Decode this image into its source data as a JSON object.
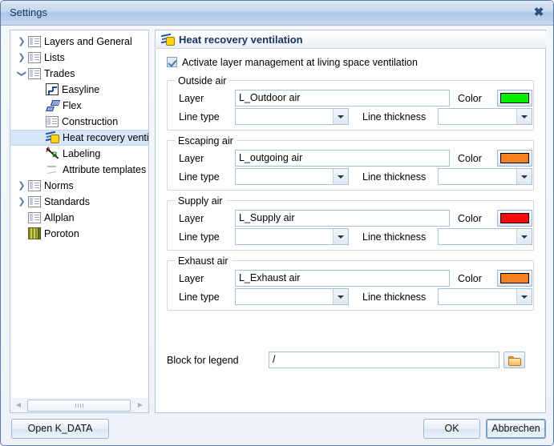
{
  "window": {
    "title": "Settings",
    "close_icon": "close-icon"
  },
  "sidebar": {
    "items": [
      {
        "label": "Layers and General",
        "icon": "page-icon",
        "twisty": "collapsed",
        "indent": 0,
        "selected": false
      },
      {
        "label": "Lists",
        "icon": "page-icon",
        "twisty": "collapsed",
        "indent": 0,
        "selected": false
      },
      {
        "label": "Trades",
        "icon": "page-icon",
        "twisty": "expanded",
        "indent": 0,
        "selected": false
      },
      {
        "label": "Easyline",
        "icon": "easyline-icon",
        "twisty": "none",
        "indent": 1,
        "selected": false
      },
      {
        "label": "Flex",
        "icon": "flex-icon",
        "twisty": "none",
        "indent": 1,
        "selected": false
      },
      {
        "label": "Construction",
        "icon": "page-icon",
        "twisty": "none",
        "indent": 1,
        "selected": false
      },
      {
        "label": "Heat recovery ventilation",
        "icon": "heat-recovery-icon",
        "twisty": "none",
        "indent": 1,
        "selected": true
      },
      {
        "label": "Labeling",
        "icon": "labeling-icon",
        "twisty": "none",
        "indent": 1,
        "selected": false
      },
      {
        "label": "Attribute templates",
        "icon": "attribute-templates-icon",
        "twisty": "none",
        "indent": 1,
        "selected": false
      },
      {
        "label": "Norms",
        "icon": "page-icon",
        "twisty": "collapsed",
        "indent": 0,
        "selected": false
      },
      {
        "label": "Standards",
        "icon": "page-icon",
        "twisty": "collapsed",
        "indent": 0,
        "selected": false
      },
      {
        "label": "Allplan",
        "icon": "page-icon",
        "twisty": "none",
        "indent": 0,
        "selected": false
      },
      {
        "label": "Poroton",
        "icon": "poroton-icon",
        "twisty": "none",
        "indent": 0,
        "selected": false
      }
    ],
    "scrollbar": {
      "left_arrow_icon": "chevron-left-icon",
      "right_arrow_icon": "chevron-right-icon"
    }
  },
  "panel": {
    "icon": "heat-recovery-icon",
    "title": "Heat recovery ventilation",
    "activate": {
      "label": "Activate layer management at living space ventilation",
      "checked": true
    },
    "groups": [
      {
        "title": "Outside air",
        "layer_label": "Layer",
        "layer_value": "L_Outdoor air",
        "color_label": "Color",
        "color_value": "#00EE00",
        "line_type_label": "Line type",
        "line_type_value": "",
        "line_thickness_label": "Line thickness",
        "line_thickness_value": ""
      },
      {
        "title": "Escaping air",
        "layer_label": "Layer",
        "layer_value": "L_outgoing air",
        "color_label": "Color",
        "color_value": "#F58220",
        "line_type_label": "Line type",
        "line_type_value": "",
        "line_thickness_label": "Line thickness",
        "line_thickness_value": ""
      },
      {
        "title": "Supply air",
        "layer_label": "Layer",
        "layer_value": "L_Supply air",
        "color_label": "Color",
        "color_value": "#FA0A0A",
        "line_type_label": "Line type",
        "line_type_value": "",
        "line_thickness_label": "Line thickness",
        "line_thickness_value": ""
      },
      {
        "title": "Exhaust air",
        "layer_label": "Layer",
        "layer_value": "L_Exhaust air",
        "color_label": "Color",
        "color_value": "#F58220",
        "line_type_label": "Line type",
        "line_type_value": "",
        "line_thickness_label": "Line thickness",
        "line_thickness_value": ""
      }
    ],
    "legend": {
      "label": "Block for legend",
      "value": "/",
      "browse_icon": "folder-icon"
    }
  },
  "footer": {
    "open_data_label": "Open K_DATA",
    "ok_label": "OK",
    "cancel_label": "Abbrechen"
  }
}
